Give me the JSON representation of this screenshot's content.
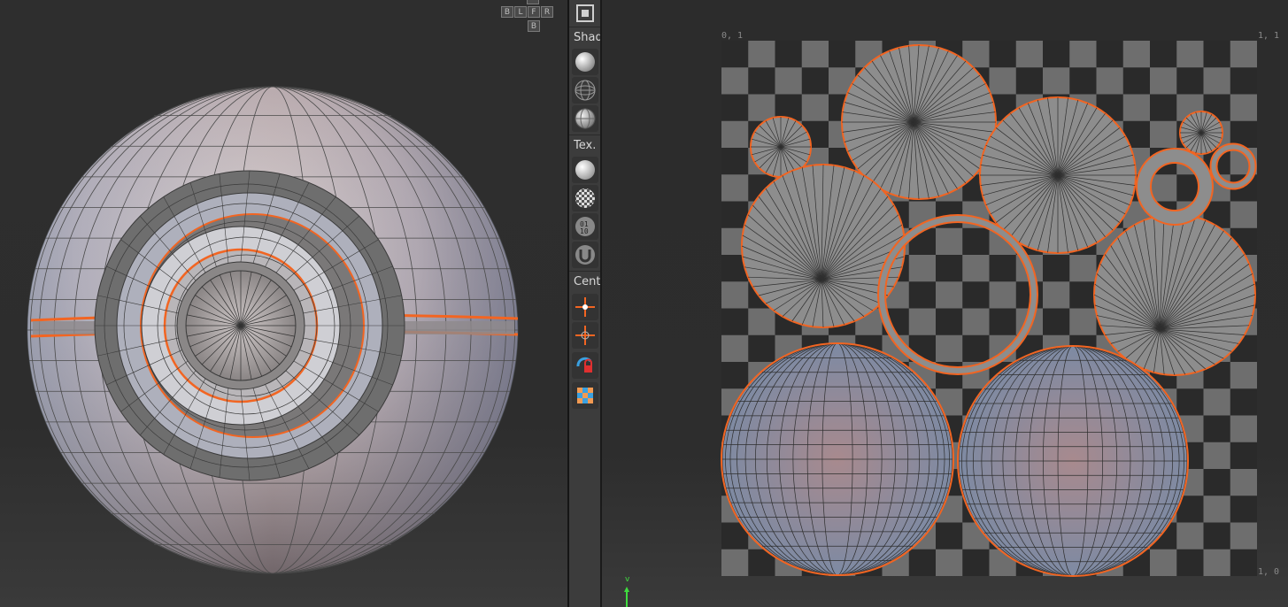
{
  "nav_cube": {
    "top": "",
    "back": "B",
    "left": "L",
    "front": "F",
    "right": "R",
    "bottom": "B"
  },
  "toolbar": {
    "shading_label": "Shad",
    "texture_label": "Tex.",
    "center_label": "Cent",
    "shading_buttons": [
      "sphere-shaded-icon",
      "sphere-wireframe-icon",
      "sphere-faceted-icon"
    ],
    "texture_buttons": [
      "texture-plain-icon",
      "texture-checker-icon",
      "texture-binary-icon",
      "texture-uv-icon"
    ],
    "center_buttons": [
      "center-pivot-icon",
      "center-selection-icon",
      "lock-rotate-icon",
      "checker-grid-icon"
    ]
  },
  "uv_editor": {
    "corner_top_left": "0, 1",
    "corner_top_right": "1, 1",
    "corner_bottom_right": "1, 0",
    "axis_label": "v"
  },
  "colors": {
    "seam": "#f26522",
    "mesh": "#8c8c8c",
    "checker_dark": "#2a2a2a",
    "checker_light": "#6e6e6e",
    "axis": "#3fdc3f"
  }
}
